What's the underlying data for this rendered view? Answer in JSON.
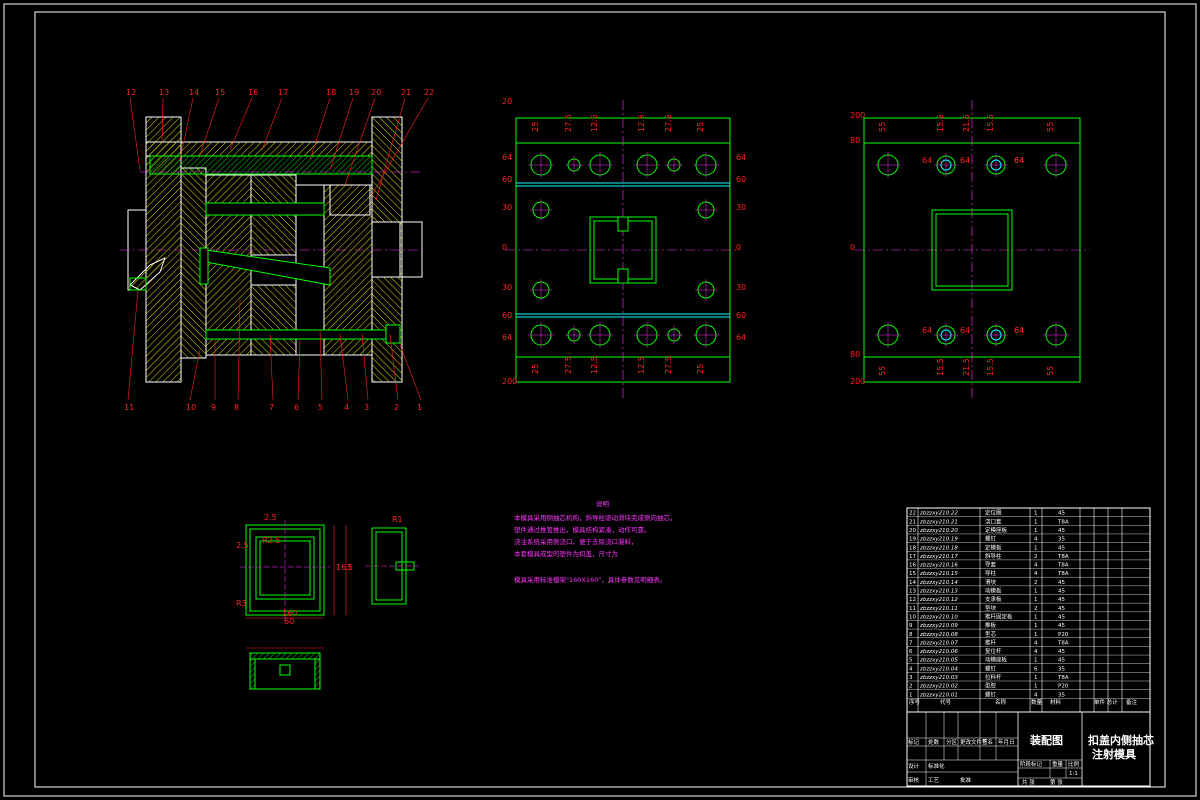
{
  "drawing": {
    "balloons_top": [
      "12",
      "13",
      "14",
      "15",
      "16",
      "17",
      "18",
      "19",
      "20",
      "21",
      "22"
    ],
    "balloons_bottom": [
      "11",
      "10",
      "9",
      "8",
      "7",
      "6",
      "5",
      "4",
      "3",
      "2",
      "1"
    ],
    "plate1_dims_left": [
      "20",
      "64",
      "60",
      "30",
      "0",
      "30",
      "60",
      "64",
      "200"
    ],
    "plate1_dims_right": [
      "64",
      "60",
      "30",
      "0",
      "30",
      "60",
      "64"
    ],
    "plate1_dims_top": [
      "25",
      "27.5",
      "12.5",
      "12.5",
      "27.5",
      "25"
    ],
    "plate2_dims_left": [
      "200",
      "80",
      "0",
      "80",
      "200"
    ],
    "plate2_dims_top": [
      "55",
      "15.5",
      "21.5",
      "15.5",
      "55"
    ],
    "plate2_small": [
      "64",
      "64",
      "64",
      "64",
      "64",
      "64",
      "64",
      "64"
    ],
    "part_dims": [
      "2.5",
      "2.5",
      "R2.5",
      "160",
      "60",
      "163",
      "5",
      "R1",
      "R3"
    ]
  },
  "notes": {
    "title": "说明",
    "lines": [
      "本模具采用侧抽芯机构，斜导柱驱动滑块完成侧向抽芯，",
      "塑件通过推管推出，模具结构紧凑，动作可靠。",
      "浇注系统采用侧浇口，便于去除浇口凝料，",
      "本套模具成型的塑件为扣盖，尺寸为",
      "模具采用标准模架\"160X160\"，具体参数见明细表。"
    ],
    "highlight": "\"160X160\""
  },
  "bom": {
    "rows": [
      {
        "no": "22",
        "code": "zbzzxy210.22",
        "name": "定位圈",
        "qty": "1",
        "mat": "45"
      },
      {
        "no": "21",
        "code": "zbzzxy210.21",
        "name": "浇口套",
        "qty": "1",
        "mat": "T8A"
      },
      {
        "no": "20",
        "code": "zbzzxy210.20",
        "name": "定模座板",
        "qty": "1",
        "mat": "45"
      },
      {
        "no": "19",
        "code": "zbzzxy210.19",
        "name": "螺钉",
        "qty": "4",
        "mat": "35"
      },
      {
        "no": "18",
        "code": "zbzzxy210.18",
        "name": "定模板",
        "qty": "1",
        "mat": "45"
      },
      {
        "no": "17",
        "code": "zbzzxy210.17",
        "name": "斜导柱",
        "qty": "2",
        "mat": "T8A"
      },
      {
        "no": "16",
        "code": "zbzzxy210.16",
        "name": "导套",
        "qty": "4",
        "mat": "T8A"
      },
      {
        "no": "15",
        "code": "zbzzxy210.15",
        "name": "导柱",
        "qty": "4",
        "mat": "T8A"
      },
      {
        "no": "14",
        "code": "zbzzxy210.14",
        "name": "滑块",
        "qty": "2",
        "mat": "45"
      },
      {
        "no": "13",
        "code": "zbzzxy210.13",
        "name": "动模板",
        "qty": "1",
        "mat": "45"
      },
      {
        "no": "12",
        "code": "zbzzxy210.12",
        "name": "支承板",
        "qty": "1",
        "mat": "45"
      },
      {
        "no": "11",
        "code": "zbzzxy210.11",
        "name": "垫块",
        "qty": "2",
        "mat": "45"
      },
      {
        "no": "10",
        "code": "zbzzxy210.10",
        "name": "推杆固定板",
        "qty": "1",
        "mat": "45"
      },
      {
        "no": "9",
        "code": "zbzzxy210.09",
        "name": "推板",
        "qty": "1",
        "mat": "45"
      },
      {
        "no": "8",
        "code": "zbzzxy210.08",
        "name": "型芯",
        "qty": "1",
        "mat": "P20"
      },
      {
        "no": "7",
        "code": "zbzzxy210.07",
        "name": "推杆",
        "qty": "4",
        "mat": "T8A"
      },
      {
        "no": "6",
        "code": "zbzzxy210.06",
        "name": "复位杆",
        "qty": "4",
        "mat": "45"
      },
      {
        "no": "5",
        "code": "zbzzxy210.05",
        "name": "动模座板",
        "qty": "1",
        "mat": "45"
      },
      {
        "no": "4",
        "code": "zbzzxy210.04",
        "name": "螺钉",
        "qty": "6",
        "mat": "35"
      },
      {
        "no": "3",
        "code": "zbzzxy210.03",
        "name": "拉料杆",
        "qty": "1",
        "mat": "T8A"
      },
      {
        "no": "2",
        "code": "zbzzxy210.02",
        "name": "型腔",
        "qty": "1",
        "mat": "P20"
      },
      {
        "no": "1",
        "code": "zbzzxy210.01",
        "name": "螺钉",
        "qty": "4",
        "mat": "35"
      }
    ],
    "header": {
      "no": "序号",
      "code": "代号",
      "name": "名称",
      "qty": "数量",
      "mat": "材料",
      "weight": "单件 总计",
      "remark": "备注"
    }
  },
  "titleblock": {
    "drawing_name": "装配图",
    "product": [
      "扣盖内侧抽芯",
      "注射模具"
    ],
    "scale": "1:1",
    "labels": [
      "标记",
      "处数",
      "分区",
      "更改文件号",
      "签名",
      "年月日",
      "设计",
      "标准化",
      "阶段标记",
      "重量",
      "比例",
      "审核",
      "工艺",
      "批准",
      "共 张",
      "第 张"
    ]
  },
  "colors": {
    "frame": "#ffffff",
    "green": "#00ff00",
    "red": "#ff2020",
    "hatch": "#ffff00",
    "magenta": "#ff33ff",
    "cyan": "#00ffff"
  }
}
